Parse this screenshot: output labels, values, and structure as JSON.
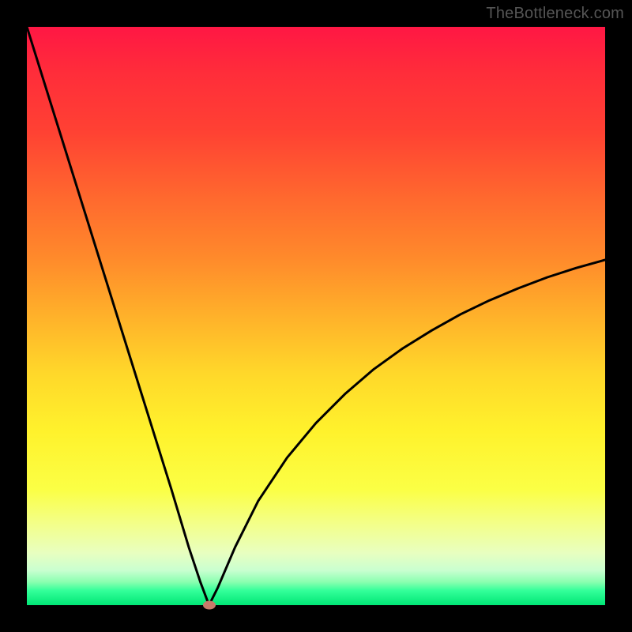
{
  "watermark": "TheBottleneck.com",
  "colors": {
    "marker": "#c77a6a"
  },
  "chart_data": {
    "type": "line",
    "title": "",
    "xlabel": "",
    "ylabel": "",
    "xlim": [
      0,
      100
    ],
    "ylim": [
      0,
      100
    ],
    "grid": false,
    "legend": false,
    "series": [
      {
        "name": "bottleneck-curve",
        "x": [
          0,
          5,
          10,
          15,
          20,
          25,
          28,
          30,
          31.5,
          33,
          36,
          40,
          45,
          50,
          55,
          60,
          65,
          70,
          75,
          80,
          85,
          90,
          95,
          100
        ],
        "y": [
          100,
          84,
          68,
          52,
          36,
          20,
          10,
          4,
          0,
          3,
          10,
          18,
          25.5,
          31.5,
          36.5,
          40.8,
          44.4,
          47.5,
          50.3,
          52.7,
          54.8,
          56.7,
          58.3,
          59.7
        ]
      }
    ],
    "marker": {
      "x": 31.5,
      "y": 0
    }
  }
}
